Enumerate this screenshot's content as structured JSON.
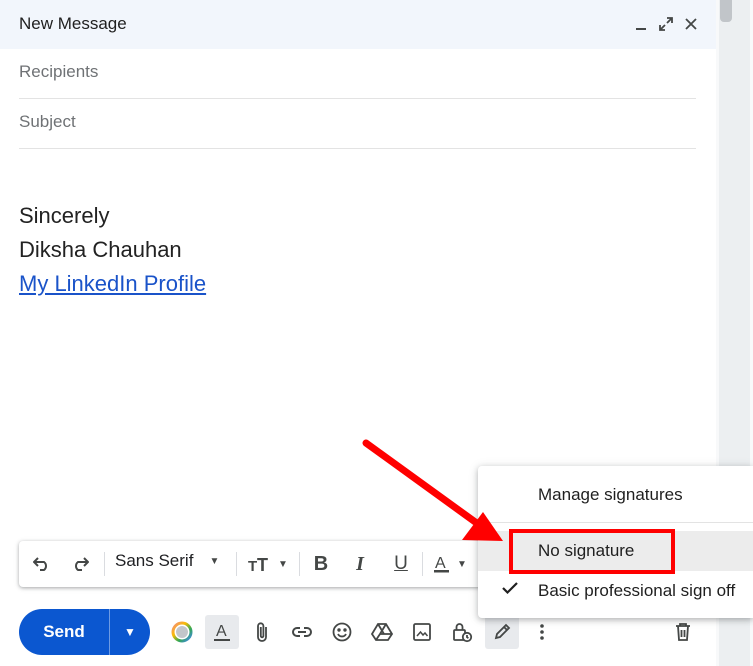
{
  "header": {
    "title": "New Message"
  },
  "fields": {
    "recipients_placeholder": "Recipients",
    "subject_placeholder": "Subject"
  },
  "body": {
    "line1": "Sincerely",
    "line2": "Diksha Chauhan",
    "link_text": "My LinkedIn Profile"
  },
  "format_bar": {
    "font_name": "Sans Serif"
  },
  "send": {
    "label": "Send"
  },
  "signature_menu": {
    "manage": "Manage signatures",
    "items": [
      {
        "label": "No signature",
        "checked": false,
        "highlighted": true
      },
      {
        "label": "Basic professional sign off",
        "checked": true,
        "highlighted": false
      }
    ]
  },
  "colors": {
    "send_blue": "#0b57d0",
    "link_blue": "#1a53c9",
    "annotation_red": "#ff0000",
    "header_bg": "#f2f6fc"
  },
  "icons": [
    "minimize-icon",
    "fullscreen-icon",
    "close-icon",
    "undo-icon",
    "redo-icon",
    "text-size-icon",
    "bold-icon",
    "italic-icon",
    "underline-icon",
    "text-color-icon",
    "ai-icon",
    "format-toggle-icon",
    "attach-icon",
    "link-icon",
    "emoji-icon",
    "drive-icon",
    "photo-icon",
    "confidential-icon",
    "signature-icon",
    "more-options-icon",
    "trash-icon",
    "checkmark-icon"
  ]
}
